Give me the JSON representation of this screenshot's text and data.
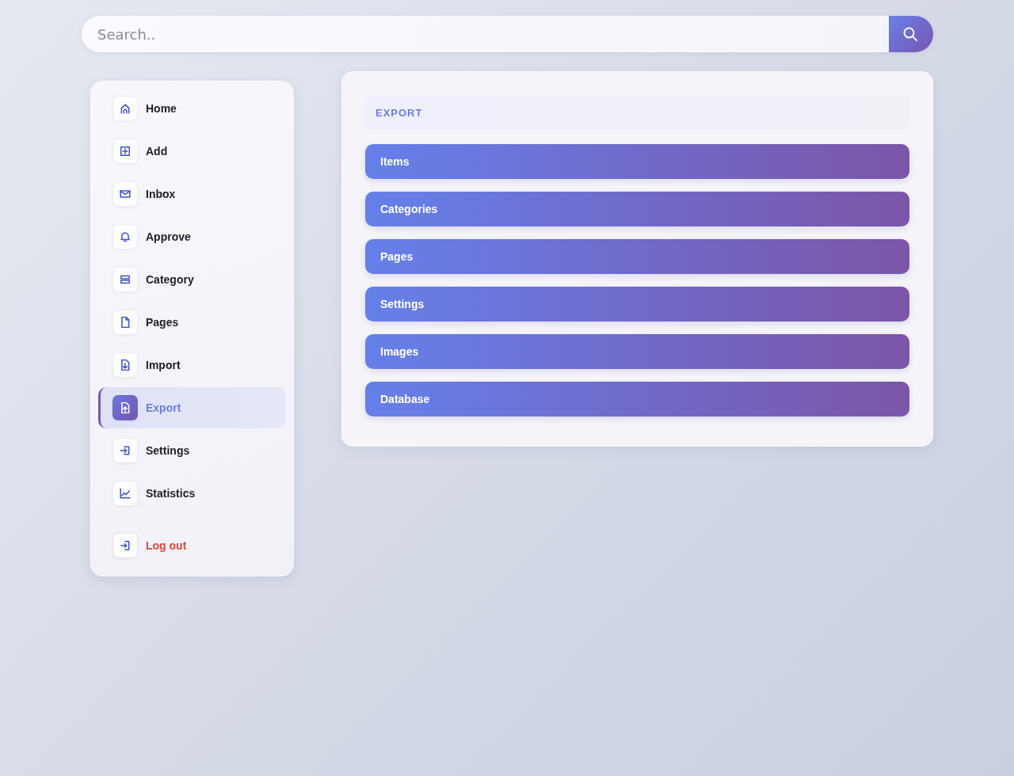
{
  "search": {
    "placeholder": "Search.."
  },
  "sidebar": {
    "items": [
      {
        "label": "Home",
        "selected": false
      },
      {
        "label": "Add",
        "selected": false
      },
      {
        "label": "Inbox",
        "selected": false
      },
      {
        "label": "Approve",
        "selected": false
      },
      {
        "label": "Category",
        "selected": false
      },
      {
        "label": "Pages",
        "selected": false
      },
      {
        "label": "Import",
        "selected": false
      },
      {
        "label": "Export",
        "selected": true
      },
      {
        "label": "Settings",
        "selected": false
      },
      {
        "label": "Statistics",
        "selected": false
      }
    ],
    "logout": {
      "label": "Log out"
    }
  },
  "panel": {
    "title": "EXPORT",
    "buttons": [
      "Items",
      "Categories",
      "Pages",
      "Settings",
      "Images",
      "Database"
    ]
  }
}
